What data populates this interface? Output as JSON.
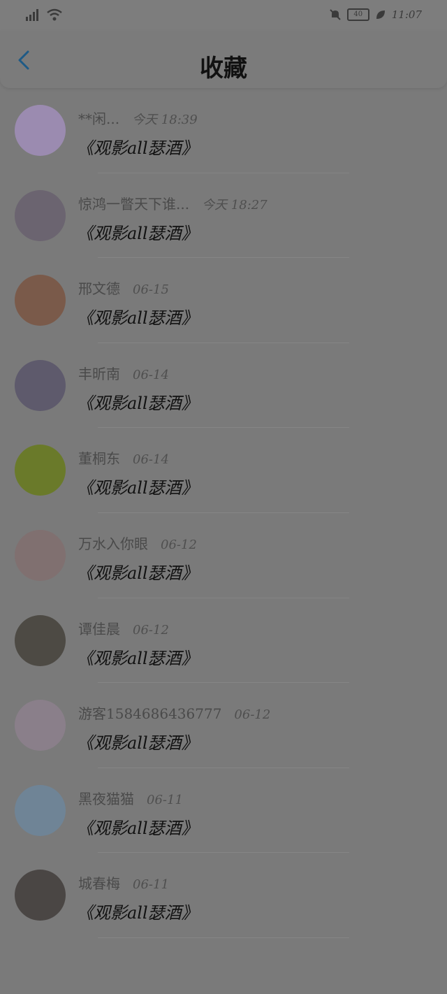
{
  "status_bar": {
    "battery": "40",
    "time": "11:07"
  },
  "header": {
    "title": "收藏"
  },
  "items": [
    {
      "name": "**闲...",
      "date": "今天 18:39",
      "content": "《观影all瑟酒》",
      "avatar_color": "#9b8bb0"
    },
    {
      "name": "惊鸿一瞥天下谁...",
      "date": "今天 18:27",
      "content": "《观影all瑟酒》",
      "avatar_color": "#6b6470"
    },
    {
      "name": "邢文德",
      "date": "06-15",
      "content": "《观影all瑟酒》",
      "avatar_color": "#7a5a4a"
    },
    {
      "name": "丰昕南",
      "date": "06-14",
      "content": "《观影all瑟酒》",
      "avatar_color": "#5e5a6c"
    },
    {
      "name": "董桐东",
      "date": "06-14",
      "content": "《观影all瑟酒》",
      "avatar_color": "#6a7a2a"
    },
    {
      "name": "万水入你眼",
      "date": "06-12",
      "content": "《观影all瑟酒》",
      "avatar_color": "#807070"
    },
    {
      "name": "谭佳晨",
      "date": "06-12",
      "content": "《观影all瑟酒》",
      "avatar_color": "#4d4a44"
    },
    {
      "name": "游客1584686436777",
      "date": "06-12",
      "content": "《观影all瑟酒》",
      "avatar_color": "#8a7f8a"
    },
    {
      "name": "黑夜猫猫",
      "date": "06-11",
      "content": "《观影all瑟酒》",
      "avatar_color": "#6f8496"
    },
    {
      "name": "城春梅",
      "date": "06-11",
      "content": "《观影all瑟酒》",
      "avatar_color": "#4a4644"
    }
  ]
}
